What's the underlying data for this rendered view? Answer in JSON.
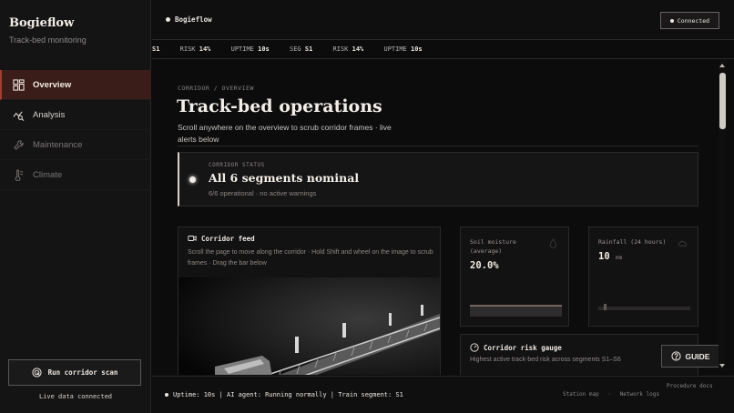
{
  "sidebar": {
    "brand": "Bogieflow",
    "subtitle": "Track-bed monitoring",
    "items": [
      {
        "label": "Overview",
        "icon": "dashboard-icon"
      },
      {
        "label": "Analysis",
        "icon": "trend-analysis-icon"
      },
      {
        "label": "Maintenance",
        "icon": "wrench-icon"
      },
      {
        "label": "Climate",
        "icon": "thermometer-icon"
      }
    ],
    "run_button": "Run corridor scan",
    "live_status": "Live data connected"
  },
  "topbar": {
    "title": "Bogieflow",
    "connection": "Connected"
  },
  "ticker": {
    "items": [
      {
        "label": "S1",
        "value": ""
      },
      {
        "label": "RISK",
        "value": "14%"
      },
      {
        "label": "UPTIME",
        "value": "10s"
      },
      {
        "label": "SEG",
        "value": "S1"
      },
      {
        "label": "RISK",
        "value": "14%"
      },
      {
        "label": "UPTIME",
        "value": "10s"
      }
    ]
  },
  "main": {
    "breadcrumb": "CORRIDOR / OVERVIEW",
    "title": "Track-bed operations",
    "lead": "Scroll anywhere on the overview to scrub corridor frames · live alerts below",
    "status": {
      "label": "CORRIDOR STATUS",
      "title": "All 6 segments nominal",
      "sub": "6/6 operational · no active warnings"
    },
    "feed": {
      "title": "Corridor feed",
      "desc": "Scroll the page to move along the corridor · Hold Shift and wheel on the image to scrub frames · Drag the bar below"
    },
    "soil": {
      "label_line1": "Soil moisture",
      "label_line2": "(average)",
      "value": "20.0%",
      "icon": "droplet-icon"
    },
    "rain": {
      "label": "Rainfall (24 hours)",
      "value": "10",
      "unit": "mm",
      "icon": "cloud-icon"
    },
    "risk": {
      "title": "Corridor risk gauge",
      "desc": "Highest active track-bed risk across segments S1–S6"
    },
    "guide_button": "GUIDE"
  },
  "footer": {
    "status": "Uptime: 10s | AI agent: Running normally | Train segment: S1",
    "links": [
      "Station map",
      "·",
      "Network logs"
    ],
    "procedure": "Procedure docs"
  },
  "colors": {
    "accent": "#a0402f",
    "active_bg": "#3a1d18",
    "background": "#0c0c0d"
  }
}
